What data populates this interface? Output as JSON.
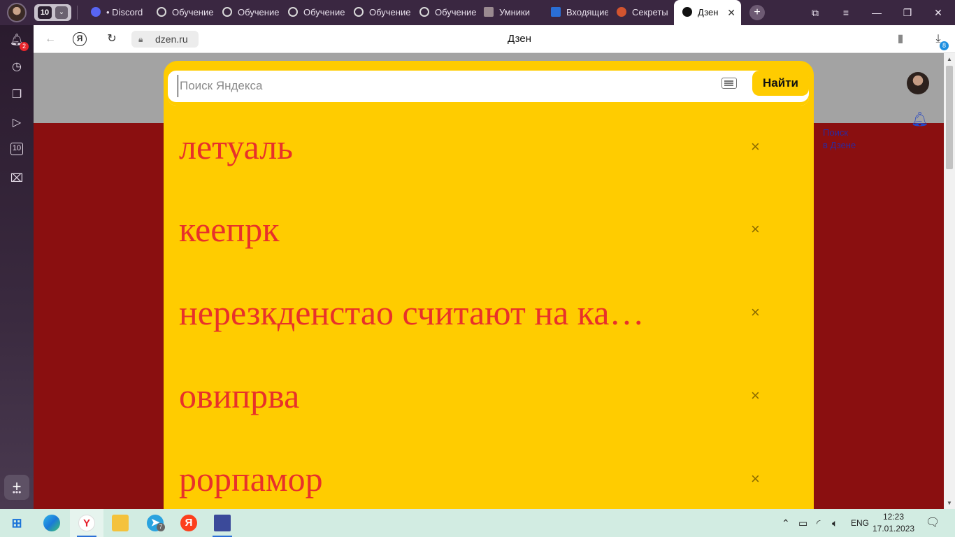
{
  "browser": {
    "tab_group_count": "10",
    "tabs": [
      {
        "label": "• Discord",
        "color": "#5865f2"
      },
      {
        "label": "Обучение",
        "color": "#d9d9d9"
      },
      {
        "label": "Обучение",
        "color": "#d9d9d9"
      },
      {
        "label": "Обучение",
        "color": "#d9d9d9"
      },
      {
        "label": "Обучение",
        "color": "#d9d9d9"
      },
      {
        "label": "Обучение",
        "color": "#d9d9d9"
      },
      {
        "label": "Умники",
        "color": "#9a8a90"
      },
      {
        "label": "Входящие",
        "color": "#2a6fd6"
      },
      {
        "label": "Секреты",
        "color": "#d3542f"
      }
    ],
    "active_tab": {
      "label": "Дзен",
      "close": "✕"
    },
    "new_tab": "+",
    "window_buttons": [
      "⧉",
      "≡",
      "—",
      "❐",
      "✕"
    ]
  },
  "sidebar": {
    "notifications_badge": "2",
    "icons": [
      "bell-icon",
      "history-icon",
      "collections-icon",
      "video-icon",
      "tabs-count-icon",
      "screenshot-icon"
    ],
    "tabs_count": "10",
    "add": "+",
    "more": "•••"
  },
  "addressbar": {
    "url": "dzen.ru",
    "title": "Дзен",
    "downloads_badge": "8"
  },
  "page": {
    "search_in_dzen_line1": "Поиск",
    "search_in_dzen_line2": "в Дзене"
  },
  "search": {
    "placeholder": "Поиск Яндекса",
    "button": "Найти",
    "suggestions": [
      "летуаль",
      "кеепрк",
      "нерезкденстао считают на ка…",
      "овипрва",
      "рорпамор"
    ],
    "remove_symbol": "×"
  },
  "taskbar": {
    "lang": "ENG",
    "time": "12:23",
    "date": "17.01.2023",
    "telegram_badge": "7"
  }
}
